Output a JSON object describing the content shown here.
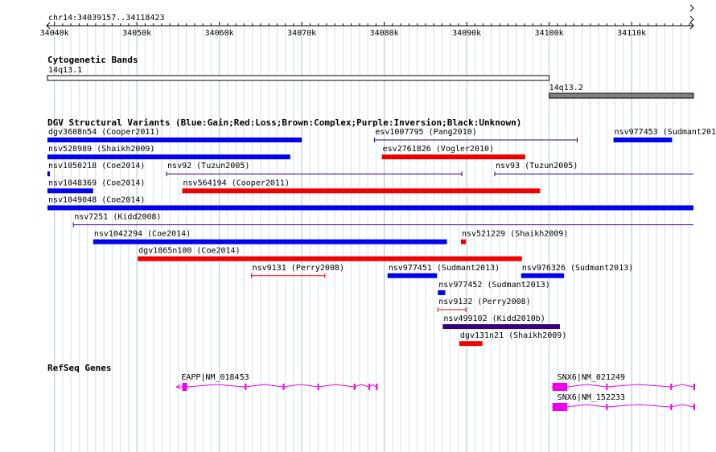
{
  "region": {
    "label": "chr14:34039157..34118423",
    "start": 34039157,
    "end": 34118423
  },
  "ruler": {
    "ticks": [
      {
        "pos": 34040000,
        "label": "34040k"
      },
      {
        "pos": 34050000,
        "label": "34050k"
      },
      {
        "pos": 34060000,
        "label": "34060k"
      },
      {
        "pos": 34070000,
        "label": "34070k"
      },
      {
        "pos": 34080000,
        "label": "34080k"
      },
      {
        "pos": 34090000,
        "label": "34090k"
      },
      {
        "pos": 34100000,
        "label": "34100k"
      },
      {
        "pos": 34110000,
        "label": "34110k"
      }
    ],
    "minor_tick_step": 1000
  },
  "cytoband_track": {
    "title": "Cytogenetic Bands",
    "bands": [
      {
        "name": "14q13.1",
        "start": 34039157,
        "end": 34100000,
        "fill": "#ffffff"
      },
      {
        "name": "14q13.2",
        "start": 34100000,
        "end": 34118423,
        "fill": "#808080"
      }
    ]
  },
  "dgv_track": {
    "title": "DGV Structural Variants (Blue:Gain;Red:Loss;Brown:Complex;Purple:Inversion;Black:Unknown)",
    "colors": {
      "gain": "#0000ee",
      "loss": "#ee0000",
      "inversion": "#330077"
    },
    "variants": [
      {
        "id": "dgv3608n54 (Cooper2011)",
        "start": 34039157,
        "end": 34070000,
        "type": "gain",
        "row": 0,
        "style": "bar"
      },
      {
        "id": "esv1007795 (Pang2010)",
        "start": 34078800,
        "end": 34103400,
        "type": "inversion",
        "row": 0,
        "style": "line"
      },
      {
        "id": "nsv977453 (Sudmant2013)",
        "start": 34107800,
        "end": 34114900,
        "type": "gain",
        "row": 0,
        "style": "bar"
      },
      {
        "id": "nsv528989 (Shaikh2009)",
        "start": 34039157,
        "end": 34068600,
        "type": "gain",
        "row": 1,
        "style": "bar"
      },
      {
        "id": "esv2761826 (Vogler2010)",
        "start": 34079700,
        "end": 34097100,
        "type": "loss",
        "row": 1,
        "style": "bar"
      },
      {
        "id": "nsv1050218 (Coe2014)",
        "start": 34039157,
        "end": 34039300,
        "type": "gain",
        "row": 2,
        "style": "bar"
      },
      {
        "id": "nsv92 (Tuzun2005)",
        "start": 34053600,
        "end": 34089400,
        "type": "inversion",
        "row": 2,
        "style": "line"
      },
      {
        "id": "nsv93 (Tuzun2005)",
        "start": 34093400,
        "end": 34118423,
        "type": "inversion",
        "row": 2,
        "style": "line"
      },
      {
        "id": "nsv1048369 (Coe2014)",
        "start": 34039157,
        "end": 34044700,
        "type": "gain",
        "row": 3,
        "style": "bar"
      },
      {
        "id": "nsv564194 (Cooper2011)",
        "start": 34055500,
        "end": 34098900,
        "type": "loss",
        "row": 3,
        "style": "bar"
      },
      {
        "id": "nsv1049048 (Coe2014)",
        "start": 34039157,
        "end": 34118423,
        "type": "gain",
        "row": 4,
        "style": "bar"
      },
      {
        "id": "nsv7251 (Kidd2008)",
        "start": 34042300,
        "end": 34118423,
        "type": "inversion",
        "row": 5,
        "style": "line"
      },
      {
        "id": "nsv1042294 (Coe2014)",
        "start": 34044700,
        "end": 34087600,
        "type": "gain",
        "row": 6,
        "style": "bar"
      },
      {
        "id": "nsv521229 (Shaikh2009)",
        "start": 34089300,
        "end": 34089900,
        "type": "loss",
        "row": 6,
        "style": "bar"
      },
      {
        "id": "dgv1865n100 (Coe2014)",
        "start": 34050100,
        "end": 34096700,
        "type": "loss",
        "row": 7,
        "style": "bar"
      },
      {
        "id": "nsv9131 (Perry2008)",
        "start": 34063900,
        "end": 34072800,
        "type": "loss",
        "row": 8,
        "style": "line"
      },
      {
        "id": "nsv977451 (Sudmant2013)",
        "start": 34080400,
        "end": 34086400,
        "type": "gain",
        "row": 8,
        "style": "bar"
      },
      {
        "id": "nsv976326 (Sudmant2013)",
        "start": 34096600,
        "end": 34101800,
        "type": "gain",
        "row": 8,
        "style": "bar"
      },
      {
        "id": "nsv977452 (Sudmant2013)",
        "start": 34086500,
        "end": 34087400,
        "type": "gain",
        "row": 9,
        "style": "bar"
      },
      {
        "id": "nsv9132 (Perry2008)",
        "start": 34086500,
        "end": 34089900,
        "type": "loss",
        "row": 10,
        "style": "line"
      },
      {
        "id": "nsv499102 (Kidd2010b)",
        "start": 34087100,
        "end": 34101300,
        "type": "inversion",
        "row": 11,
        "style": "bar"
      },
      {
        "id": "dgv131n21 (Shaikh2009)",
        "start": 34089100,
        "end": 34091900,
        "type": "loss",
        "row": 12,
        "style": "bar"
      }
    ]
  },
  "refseq_track": {
    "title": "RefSeq Genes",
    "color": "#ee00ee",
    "genes": [
      {
        "name": "EAPP|NM_018453",
        "start": 34054800,
        "end": 34079200,
        "strand": "-",
        "row": 0,
        "exons": [
          [
            34055500,
            34056100
          ],
          [
            34063100,
            34063200
          ],
          [
            34067700,
            34067800
          ],
          [
            34071900,
            34072000
          ],
          [
            34076300,
            34076400
          ],
          [
            34078100,
            34078200
          ],
          [
            34079000,
            34079200
          ]
        ]
      },
      {
        "name": "SNX6|NM_021249",
        "start": 34100400,
        "end": 34118423,
        "strand": "-",
        "row": 0,
        "exons": [
          [
            34100400,
            34102200
          ],
          [
            34106900,
            34107000
          ],
          [
            34114700,
            34114800
          ],
          [
            34118200,
            34118423
          ]
        ]
      },
      {
        "name": "SNX6|NM_152233",
        "start": 34100400,
        "end": 34118423,
        "strand": "-",
        "row": 1,
        "exons": [
          [
            34100400,
            34102200
          ],
          [
            34106900,
            34107000
          ],
          [
            34114700,
            34114800
          ],
          [
            34118200,
            34118423
          ]
        ]
      }
    ]
  }
}
